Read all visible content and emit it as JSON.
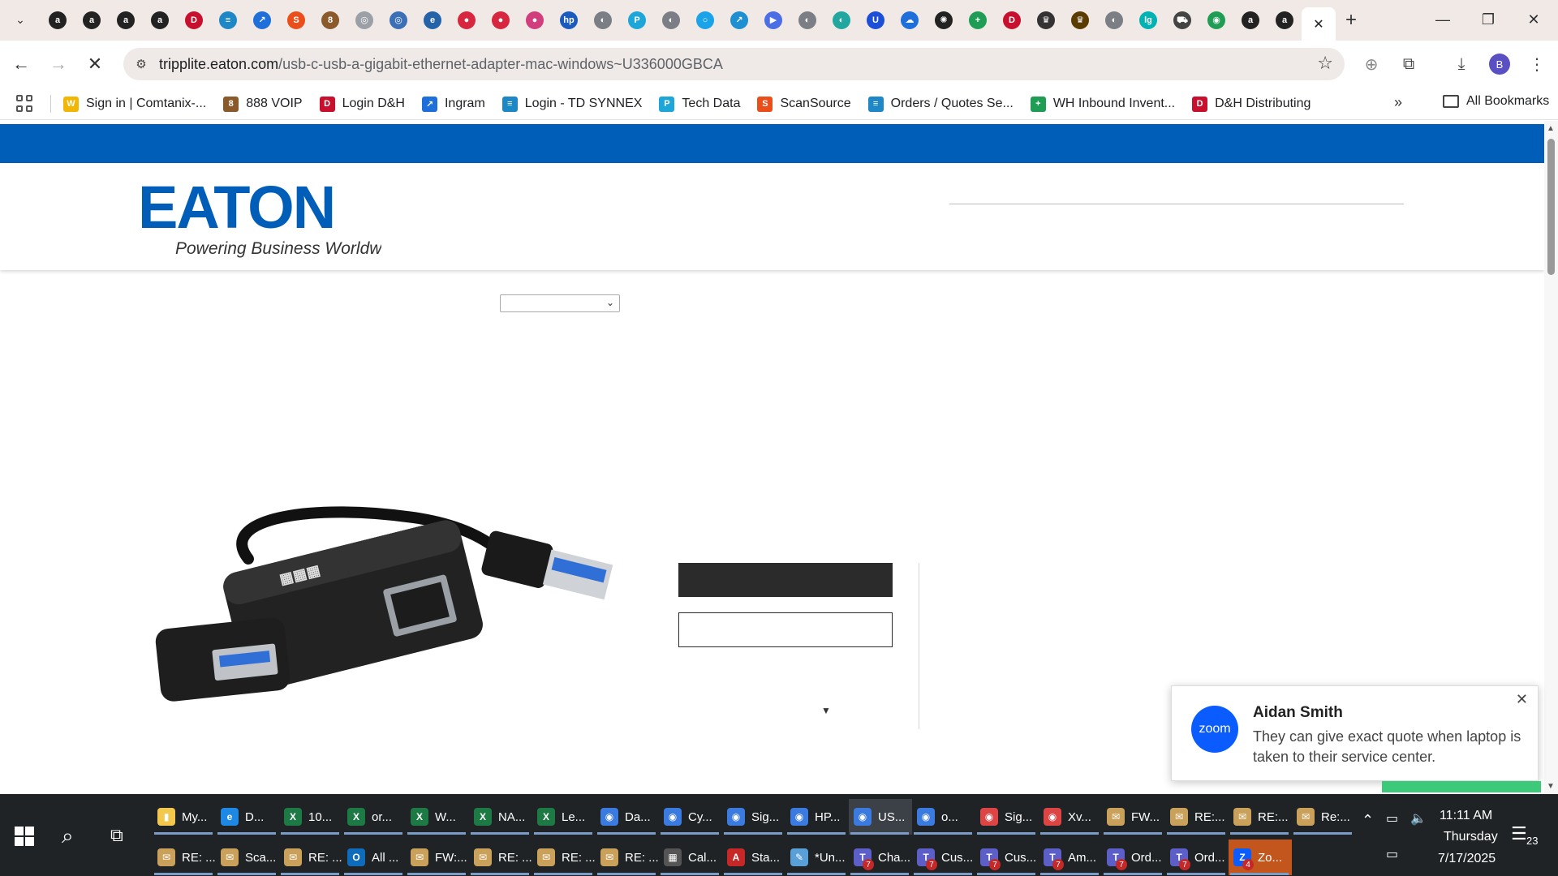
{
  "browser": {
    "url_host": "tripplite.eaton.com",
    "url_path": "/usb-c-usb-a-gigabit-ethernet-adapter-mac-windows~U336000GBCA",
    "profile_initial": "B",
    "pinned_tabs": [
      {
        "icon": "amazon-icon",
        "glyph": "a",
        "color": "#222"
      },
      {
        "icon": "amazon-icon",
        "glyph": "a",
        "color": "#222"
      },
      {
        "icon": "amazon-icon",
        "glyph": "a",
        "color": "#222"
      },
      {
        "icon": "amazon-icon",
        "glyph": "a",
        "color": "#222"
      },
      {
        "icon": "dh-icon",
        "glyph": "D",
        "color": "#c8102e"
      },
      {
        "icon": "synnex-icon",
        "glyph": "≡",
        "color": "#1e88c7"
      },
      {
        "icon": "ingram-icon",
        "glyph": "↗",
        "color": "#1e6fd9"
      },
      {
        "icon": "scansource-icon",
        "glyph": "S",
        "color": "#e94e1b"
      },
      {
        "icon": "voip-icon",
        "glyph": "8",
        "color": "#8a5a2b"
      },
      {
        "icon": "globe-icon",
        "glyph": "◎",
        "color": "#9aa0a6"
      },
      {
        "icon": "globe-icon",
        "glyph": "◎",
        "color": "#3b6fb6"
      },
      {
        "icon": "edge-icon",
        "glyph": "e",
        "color": "#2563a8"
      },
      {
        "icon": "lenovo-icon",
        "glyph": "●",
        "color": "#d7263d"
      },
      {
        "icon": "lenovo-icon",
        "glyph": "●",
        "color": "#d7263d"
      },
      {
        "icon": "lenovo-icon",
        "glyph": "●",
        "color": "#d23d7d"
      },
      {
        "icon": "hp-icon",
        "glyph": "hp",
        "color": "#1b5bbd"
      },
      {
        "icon": "globe-icon",
        "glyph": "◐",
        "color": "#7b7f85"
      },
      {
        "icon": "techdata-icon",
        "glyph": "P",
        "color": "#1ea6d9"
      },
      {
        "icon": "globe-icon",
        "glyph": "◐",
        "color": "#7b7f85"
      },
      {
        "icon": "ring-icon",
        "glyph": "○",
        "color": "#1aa3e8"
      },
      {
        "icon": "link-icon",
        "glyph": "↗",
        "color": "#1e8fd0"
      },
      {
        "icon": "arrow-icon",
        "glyph": "▶",
        "color": "#4b6de6"
      },
      {
        "icon": "globe-icon",
        "glyph": "◐",
        "color": "#7b7f85"
      },
      {
        "icon": "leaf-icon",
        "glyph": "◐",
        "color": "#22a7a0"
      },
      {
        "icon": "u-icon",
        "glyph": "U",
        "color": "#1d4ed8"
      },
      {
        "icon": "cloud-icon",
        "glyph": "☁",
        "color": "#1e6fd9"
      },
      {
        "icon": "openai-icon",
        "glyph": "✺",
        "color": "#222"
      },
      {
        "icon": "plus-icon",
        "glyph": "+",
        "color": "#1f9d55"
      },
      {
        "icon": "dh-icon",
        "glyph": "D",
        "color": "#c8102e"
      },
      {
        "icon": "crown-icon",
        "glyph": "♛",
        "color": "#333"
      },
      {
        "icon": "crown-icon",
        "glyph": "♛",
        "color": "#5a3b00"
      },
      {
        "icon": "globe-icon",
        "glyph": "◐",
        "color": "#7b7f85"
      },
      {
        "icon": "logi-icon",
        "glyph": "lg",
        "color": "#00b3b3"
      },
      {
        "icon": "car-icon",
        "glyph": "⛟",
        "color": "#444"
      },
      {
        "icon": "gpt-icon",
        "glyph": "◉",
        "color": "#1f9d55"
      },
      {
        "icon": "amazon-icon",
        "glyph": "a",
        "color": "#222"
      },
      {
        "icon": "amazon-icon",
        "glyph": "a",
        "color": "#222"
      }
    ],
    "bookmarks": [
      {
        "label": "Sign in | Comtanix-...",
        "icon": "w-icon",
        "glyph": "W",
        "color": "#f2b705"
      },
      {
        "label": "888 VOIP",
        "icon": "voip-icon",
        "glyph": "8",
        "color": "#8a5a2b"
      },
      {
        "label": "Login D&H",
        "icon": "dh-icon",
        "glyph": "D",
        "color": "#c8102e"
      },
      {
        "label": "Ingram",
        "icon": "ingram-icon",
        "glyph": "↗",
        "color": "#1e6fd9"
      },
      {
        "label": "Login - TD SYNNEX",
        "icon": "synnex-icon",
        "glyph": "≡",
        "color": "#1e88c7"
      },
      {
        "label": "Tech Data",
        "icon": "techdata-icon",
        "glyph": "P",
        "color": "#1ea6d9"
      },
      {
        "label": "ScanSource",
        "icon": "scansource-icon",
        "glyph": "S",
        "color": "#e94e1b"
      },
      {
        "label": "Orders / Quotes Se...",
        "icon": "synnex-icon",
        "glyph": "≡",
        "color": "#1e88c7"
      },
      {
        "label": "WH Inbound Invent...",
        "icon": "sheets-icon",
        "glyph": "+",
        "color": "#1f9d55"
      },
      {
        "label": "D&H Distributing",
        "icon": "dh-icon",
        "glyph": "D",
        "color": "#c8102e"
      }
    ],
    "all_bookmarks_label": "All Bookmarks"
  },
  "page": {
    "brand_color": "#005eb8",
    "logo_text": "EATON",
    "logo_tagline": "Powering Business Worldwide"
  },
  "notification": {
    "app": "zoom",
    "sender": "Aidan Smith",
    "message": "They can give exact quote when laptop is taken to their service center."
  },
  "taskbar": {
    "row1": [
      {
        "label": "My...",
        "icon": "file-explorer-icon",
        "glyph": "▮",
        "color": "#f2c94c"
      },
      {
        "label": "D...",
        "icon": "edge-icon",
        "glyph": "e",
        "color": "#1e88e5"
      },
      {
        "label": "10...",
        "icon": "excel-icon",
        "glyph": "X",
        "color": "#1d7a45"
      },
      {
        "label": "or...",
        "icon": "excel-icon",
        "glyph": "X",
        "color": "#1d7a45"
      },
      {
        "label": "W...",
        "icon": "excel-icon",
        "glyph": "X",
        "color": "#1d7a45"
      },
      {
        "label": "NA...",
        "icon": "excel-icon",
        "glyph": "X",
        "color": "#1d7a45"
      },
      {
        "label": "Le...",
        "icon": "excel-icon",
        "glyph": "X",
        "color": "#1d7a45"
      },
      {
        "label": "Da...",
        "icon": "chrome-icon",
        "glyph": "◉",
        "color": "#3b7be0"
      },
      {
        "label": "Cy...",
        "icon": "chrome-icon",
        "glyph": "◉",
        "color": "#3b7be0"
      },
      {
        "label": "Sig...",
        "icon": "chrome-icon",
        "glyph": "◉",
        "color": "#3b7be0"
      },
      {
        "label": "HP...",
        "icon": "chrome-icon",
        "glyph": "◉",
        "color": "#3b7be0"
      },
      {
        "label": "US...",
        "icon": "chrome-icon",
        "glyph": "◉",
        "color": "#3b7be0",
        "active": true
      },
      {
        "label": "o...",
        "icon": "chrome-icon",
        "glyph": "◉",
        "color": "#3b7be0"
      },
      {
        "label": "Sig...",
        "icon": "chrome-icon",
        "glyph": "◉",
        "color": "#d44"
      },
      {
        "label": "Xv...",
        "icon": "chrome-icon",
        "glyph": "◉",
        "color": "#d44"
      },
      {
        "label": "FW...",
        "icon": "mail-icon",
        "glyph": "✉",
        "color": "#caa15a"
      },
      {
        "label": "RE:...",
        "icon": "mail-icon",
        "glyph": "✉",
        "color": "#caa15a"
      },
      {
        "label": "RE:...",
        "icon": "mail-icon",
        "glyph": "✉",
        "color": "#caa15a"
      },
      {
        "label": "Re:...",
        "icon": "mail-icon",
        "glyph": "✉",
        "color": "#caa15a"
      }
    ],
    "row2": [
      {
        "label": "RE: ...",
        "icon": "mail-icon",
        "glyph": "✉",
        "color": "#caa15a"
      },
      {
        "label": "Sca...",
        "icon": "mail-icon",
        "glyph": "✉",
        "color": "#caa15a"
      },
      {
        "label": "RE: ...",
        "icon": "mail-icon",
        "glyph": "✉",
        "color": "#caa15a"
      },
      {
        "label": "All ...",
        "icon": "outlook-icon",
        "glyph": "O",
        "color": "#0f6cbd"
      },
      {
        "label": "FW:...",
        "icon": "mail-icon",
        "glyph": "✉",
        "color": "#caa15a"
      },
      {
        "label": "RE: ...",
        "icon": "mail-icon",
        "glyph": "✉",
        "color": "#caa15a"
      },
      {
        "label": "RE: ...",
        "icon": "mail-icon",
        "glyph": "✉",
        "color": "#caa15a"
      },
      {
        "label": "RE: ...",
        "icon": "mail-icon",
        "glyph": "✉",
        "color": "#caa15a"
      },
      {
        "label": "Cal...",
        "icon": "calculator-icon",
        "glyph": "▦",
        "color": "#555"
      },
      {
        "label": "Sta...",
        "icon": "pdf-icon",
        "glyph": "A",
        "color": "#c62828"
      },
      {
        "label": "*Un...",
        "icon": "notepad-icon",
        "glyph": "✎",
        "color": "#5aa0d8"
      },
      {
        "label": "Cha...",
        "icon": "teams-icon",
        "glyph": "T",
        "color": "#5b5fc7",
        "badge": "7"
      },
      {
        "label": "Cus...",
        "icon": "teams-icon",
        "glyph": "T",
        "color": "#5b5fc7",
        "badge": "7"
      },
      {
        "label": "Cus...",
        "icon": "teams-icon",
        "glyph": "T",
        "color": "#5b5fc7",
        "badge": "7"
      },
      {
        "label": "Am...",
        "icon": "teams-icon",
        "glyph": "T",
        "color": "#5b5fc7",
        "badge": "7"
      },
      {
        "label": "Ord...",
        "icon": "teams-icon",
        "glyph": "T",
        "color": "#5b5fc7",
        "badge": "7"
      },
      {
        "label": "Ord...",
        "icon": "teams-icon",
        "glyph": "T",
        "color": "#5b5fc7",
        "badge": "7"
      },
      {
        "label": "Zo...",
        "icon": "zoom-icon",
        "glyph": "Z",
        "color": "#0b5cff",
        "badge": "4",
        "active_orange": true
      }
    ],
    "time": "11:11 AM",
    "day": "Thursday",
    "date": "7/17/2025",
    "notification_count": "23"
  }
}
